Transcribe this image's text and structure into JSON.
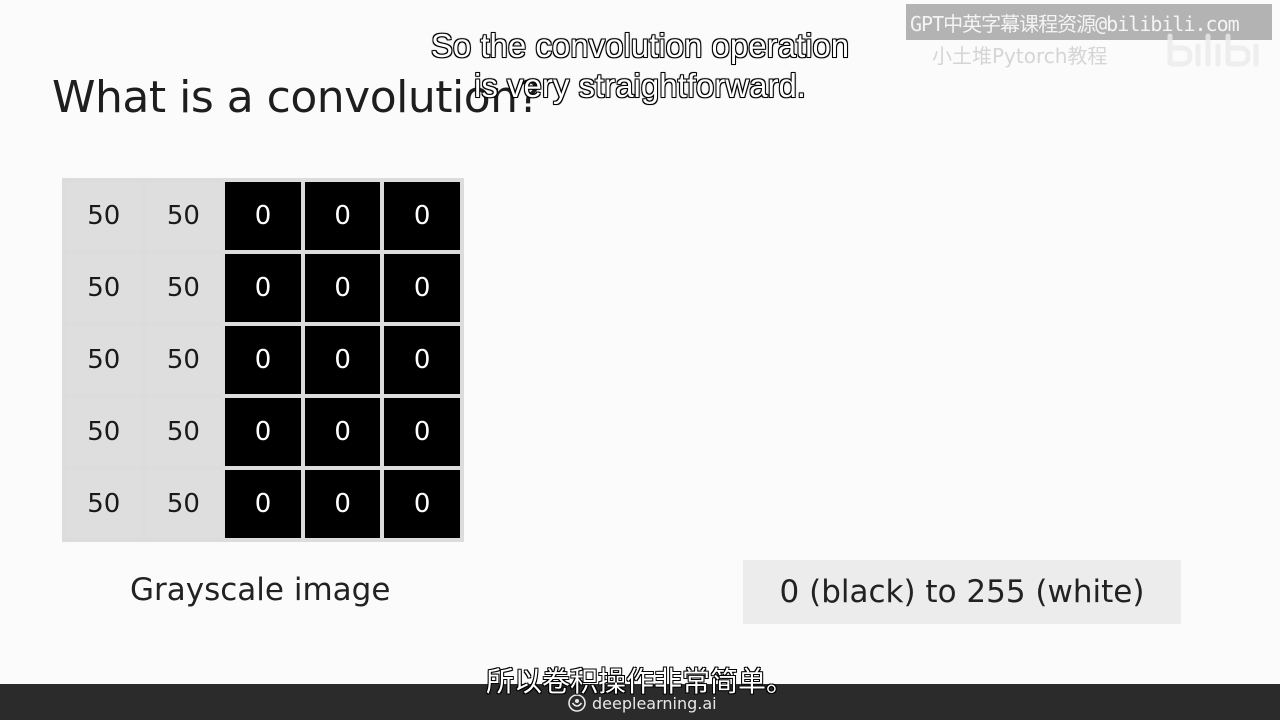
{
  "slide": {
    "title": "What is a convolution?",
    "grid_caption": "Grayscale image",
    "range_label": "0 (black) to 255 (white)"
  },
  "grid": {
    "rows": [
      [
        "50",
        "50",
        "0",
        "0",
        "0"
      ],
      [
        "50",
        "50",
        "0",
        "0",
        "0"
      ],
      [
        "50",
        "50",
        "0",
        "0",
        "0"
      ],
      [
        "50",
        "50",
        "0",
        "0",
        "0"
      ],
      [
        "50",
        "50",
        "0",
        "0",
        "0"
      ]
    ],
    "light_color": "#dedede",
    "dark_color": "#000000"
  },
  "subtitles": {
    "en_line1": "So the convolution operation",
    "en_line2": "is very straightforward.",
    "zh": "所以卷积操作非常简单。"
  },
  "watermark": {
    "line1": "GPT中英字幕课程资源@bilibili.com",
    "line2": "小土堆Pytorch教程",
    "logo_icon": "bilibili-logo-icon"
  },
  "footer": {
    "brand": "deeplearning.ai",
    "brand_icon": "deeplearning-logo-icon"
  }
}
